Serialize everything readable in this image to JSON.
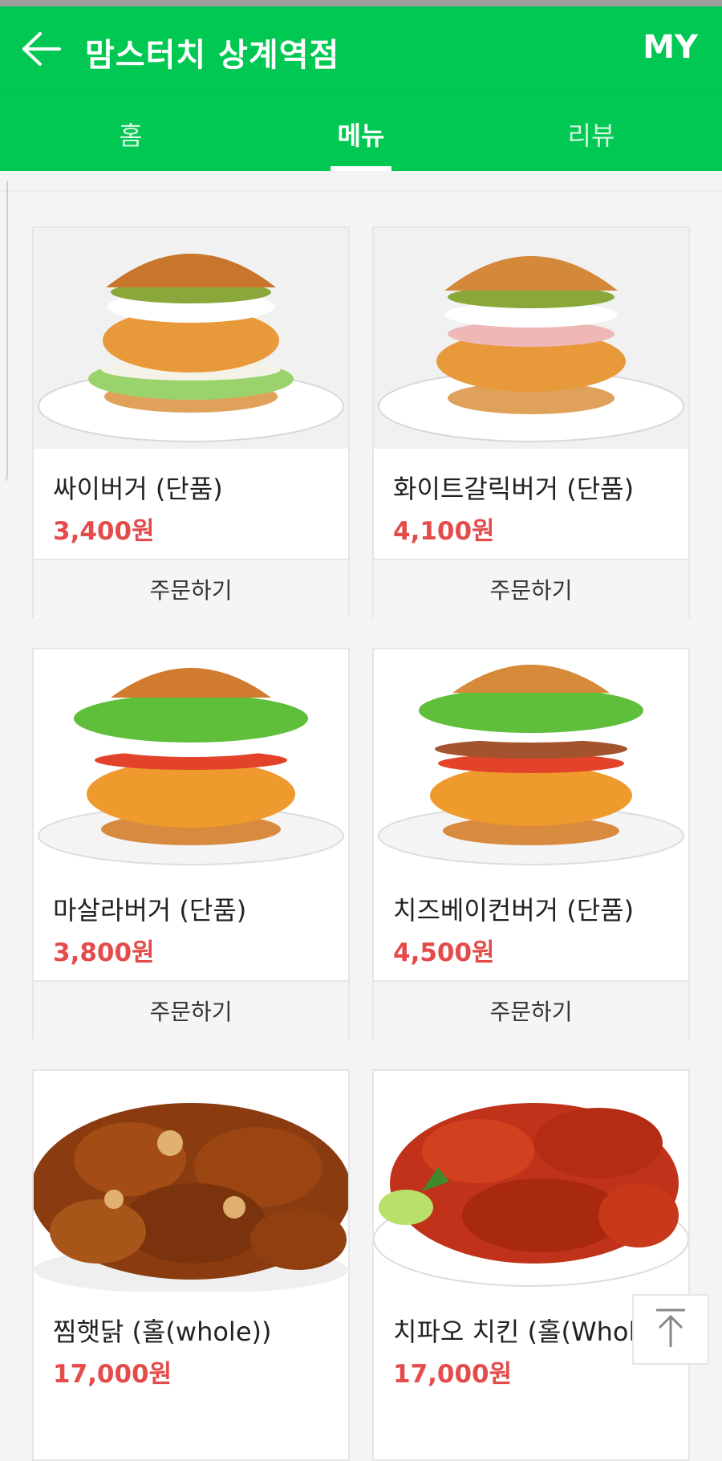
{
  "header": {
    "title": "맘스터치 상계역점",
    "my_label": "MY",
    "accent": "#00c853"
  },
  "tabs": [
    {
      "label": "홈",
      "active": false
    },
    {
      "label": "메뉴",
      "active": true
    },
    {
      "label": "리뷰",
      "active": false
    }
  ],
  "menu": {
    "items": [
      {
        "name": "싸이버거 (단품)",
        "price": "3,400원",
        "order_label": "주문하기",
        "image": "spicy-chicken-burger-photo"
      },
      {
        "name": "화이트갈릭버거 (단품)",
        "price": "4,100원",
        "order_label": "주문하기",
        "image": "white-garlic-burger-photo"
      },
      {
        "name": "마살라버거 (단품)",
        "price": "3,800원",
        "order_label": "주문하기",
        "image": "masala-burger-photo"
      },
      {
        "name": "치즈베이컨버거 (단품)",
        "price": "4,500원",
        "order_label": "주문하기",
        "image": "cheese-bacon-burger-photo"
      },
      {
        "name": "찜햇닭 (홀(whole))",
        "price": "17,000원",
        "image": "braised-chicken-photo"
      },
      {
        "name": "치파오 치킨 (홀(Whol...",
        "price": "17,000원",
        "image": "chipao-chicken-photo"
      }
    ]
  },
  "colors": {
    "price": "#e44b4b"
  },
  "scroll_top_icon": "arrow-up-icon"
}
